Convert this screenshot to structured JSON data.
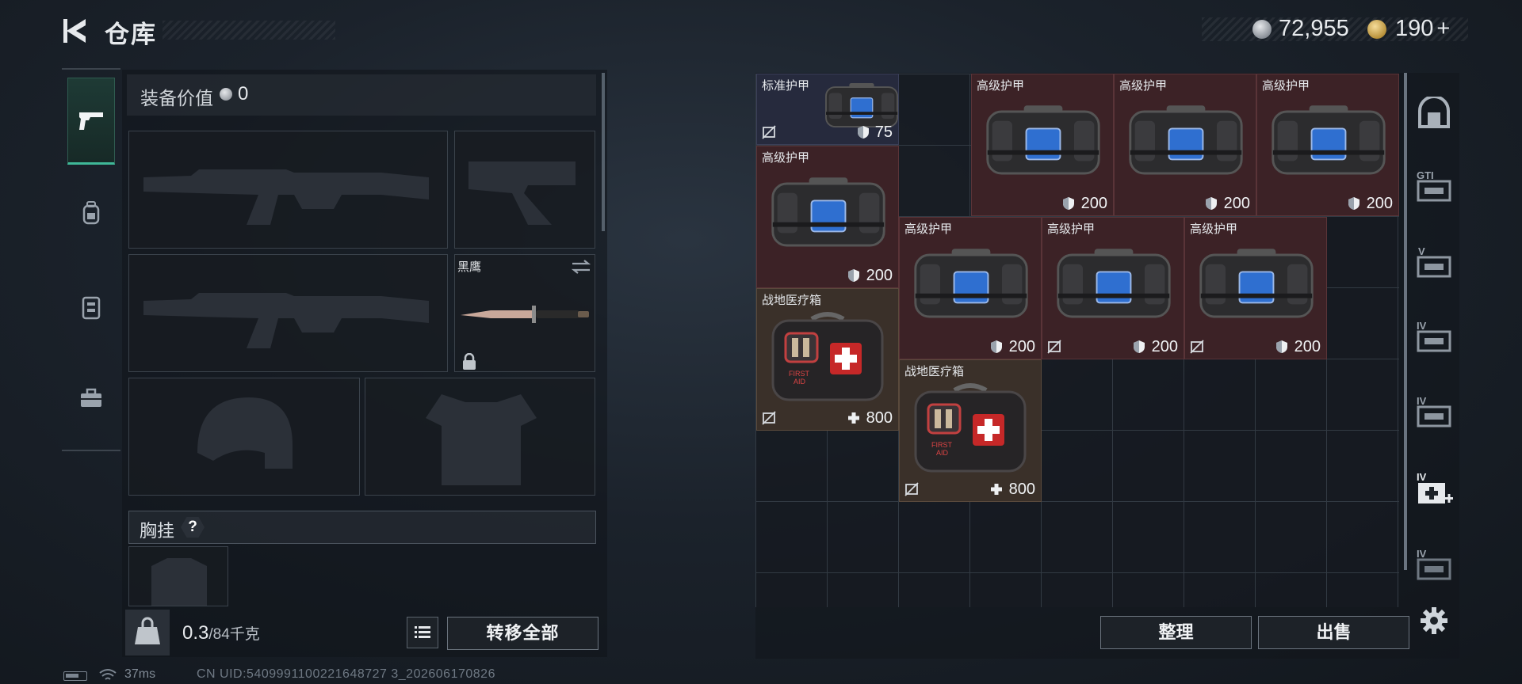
{
  "header": {
    "title": "仓库"
  },
  "currency": {
    "silver": "72,955",
    "gold": "190",
    "gold_plus": "+"
  },
  "loadout": {
    "equip_value_label": "装备价值",
    "equip_value": "0",
    "knife_name": "黑鹰",
    "chest_label": "胸挂",
    "chest_help": "?"
  },
  "weight": {
    "current": "0.3",
    "capacity": "/84千克"
  },
  "buttons": {
    "transfer_all": "转移全部",
    "sort": "整理",
    "sell": "出售"
  },
  "status": {
    "ping": "37ms",
    "uid": "CN UID:5409991100221648727 3_202606170826"
  },
  "items": [
    {
      "name": "标准护甲",
      "value": "75",
      "kind": "armor-std",
      "stat": "shield",
      "uninsured": true
    },
    {
      "name": "高级护甲",
      "value": "200",
      "kind": "armor-adv",
      "stat": "shield",
      "uninsured": false
    },
    {
      "name": "高级护甲",
      "value": "200",
      "kind": "armor-adv",
      "stat": "shield",
      "uninsured": false
    },
    {
      "name": "高级护甲",
      "value": "200",
      "kind": "armor-adv",
      "stat": "shield",
      "uninsured": false
    },
    {
      "name": "高级护甲",
      "value": "200",
      "kind": "armor-adv",
      "stat": "shield",
      "uninsured": false
    },
    {
      "name": "高级护甲",
      "value": "200",
      "kind": "armor-adv",
      "stat": "shield",
      "uninsured": false
    },
    {
      "name": "高级护甲",
      "value": "200",
      "kind": "armor-adv",
      "stat": "shield",
      "uninsured": true
    },
    {
      "name": "高级护甲",
      "value": "200",
      "kind": "armor-adv",
      "stat": "shield",
      "uninsured": true
    },
    {
      "name": "战地医疗箱",
      "value": "800",
      "kind": "medkit",
      "stat": "heal",
      "uninsured": true
    },
    {
      "name": "战地医疗箱",
      "value": "800",
      "kind": "medkit",
      "stat": "heal",
      "uninsured": true
    }
  ],
  "medkit_text": {
    "line1": "FIRST",
    "line2": "AID"
  },
  "right_rail_labels": [
    "GTI",
    "V",
    "IV",
    "IV",
    "IV",
    "IV"
  ],
  "colors": {
    "accent": "#3fb898",
    "armor_advanced": "#3c2226",
    "armor_standard": "#262a3d",
    "medkit": "#3a3029"
  }
}
